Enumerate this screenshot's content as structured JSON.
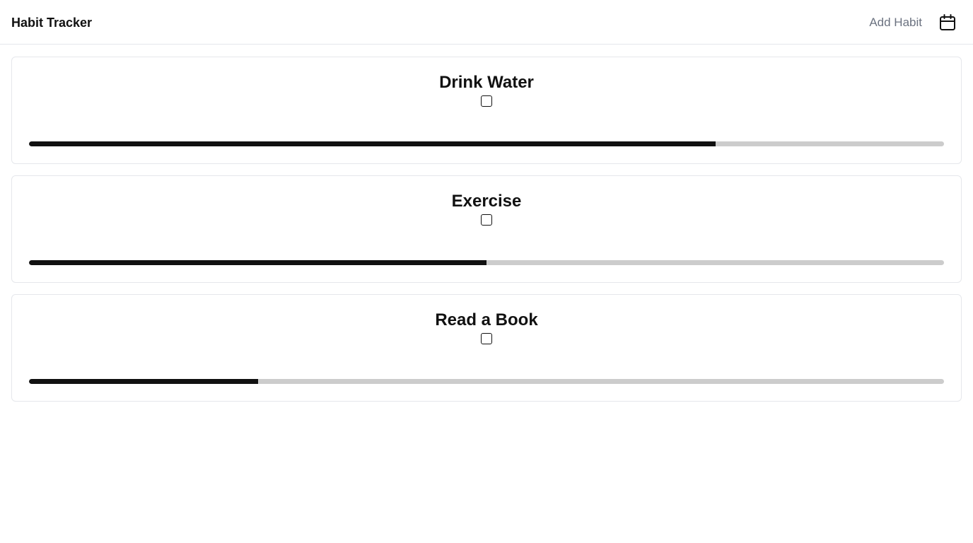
{
  "header": {
    "title": "Habit Tracker",
    "add_habit_label": "Add Habit",
    "calendar_icon": "calendar-icon"
  },
  "habits": [
    {
      "name": "Drink Water",
      "checked": false,
      "progress": 0.75
    },
    {
      "name": "Exercise",
      "checked": false,
      "progress": 0.5
    },
    {
      "name": "Read a Book",
      "checked": false,
      "progress": 0.25
    }
  ],
  "colors": {
    "progress_fill": "#111111",
    "progress_track": "#cccccc",
    "muted_text": "#6b7280",
    "border": "#e5e7eb"
  }
}
